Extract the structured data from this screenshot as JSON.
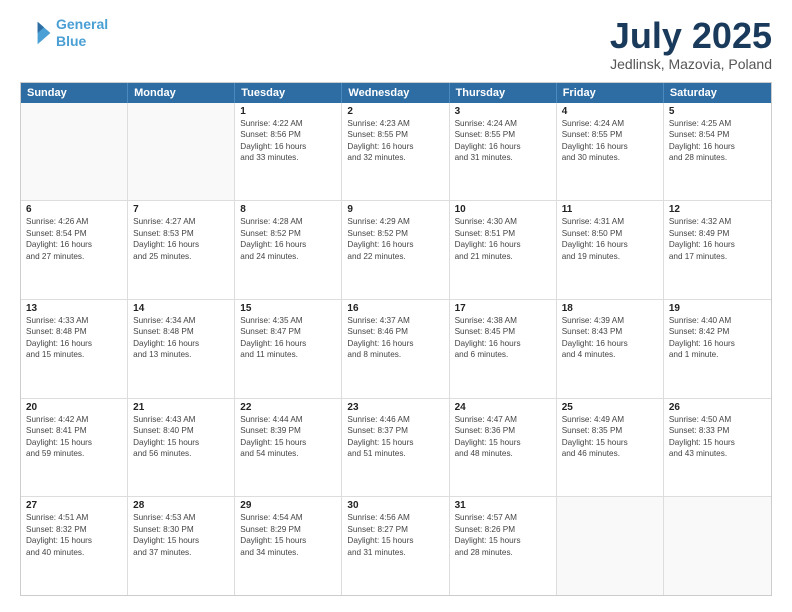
{
  "logo": {
    "line1": "General",
    "line2": "Blue"
  },
  "title": "July 2025",
  "subtitle": "Jedlinsk, Mazovia, Poland",
  "header_days": [
    "Sunday",
    "Monday",
    "Tuesday",
    "Wednesday",
    "Thursday",
    "Friday",
    "Saturday"
  ],
  "weeks": [
    [
      {
        "day": "",
        "lines": []
      },
      {
        "day": "",
        "lines": []
      },
      {
        "day": "1",
        "lines": [
          "Sunrise: 4:22 AM",
          "Sunset: 8:56 PM",
          "Daylight: 16 hours",
          "and 33 minutes."
        ]
      },
      {
        "day": "2",
        "lines": [
          "Sunrise: 4:23 AM",
          "Sunset: 8:55 PM",
          "Daylight: 16 hours",
          "and 32 minutes."
        ]
      },
      {
        "day": "3",
        "lines": [
          "Sunrise: 4:24 AM",
          "Sunset: 8:55 PM",
          "Daylight: 16 hours",
          "and 31 minutes."
        ]
      },
      {
        "day": "4",
        "lines": [
          "Sunrise: 4:24 AM",
          "Sunset: 8:55 PM",
          "Daylight: 16 hours",
          "and 30 minutes."
        ]
      },
      {
        "day": "5",
        "lines": [
          "Sunrise: 4:25 AM",
          "Sunset: 8:54 PM",
          "Daylight: 16 hours",
          "and 28 minutes."
        ]
      }
    ],
    [
      {
        "day": "6",
        "lines": [
          "Sunrise: 4:26 AM",
          "Sunset: 8:54 PM",
          "Daylight: 16 hours",
          "and 27 minutes."
        ]
      },
      {
        "day": "7",
        "lines": [
          "Sunrise: 4:27 AM",
          "Sunset: 8:53 PM",
          "Daylight: 16 hours",
          "and 25 minutes."
        ]
      },
      {
        "day": "8",
        "lines": [
          "Sunrise: 4:28 AM",
          "Sunset: 8:52 PM",
          "Daylight: 16 hours",
          "and 24 minutes."
        ]
      },
      {
        "day": "9",
        "lines": [
          "Sunrise: 4:29 AM",
          "Sunset: 8:52 PM",
          "Daylight: 16 hours",
          "and 22 minutes."
        ]
      },
      {
        "day": "10",
        "lines": [
          "Sunrise: 4:30 AM",
          "Sunset: 8:51 PM",
          "Daylight: 16 hours",
          "and 21 minutes."
        ]
      },
      {
        "day": "11",
        "lines": [
          "Sunrise: 4:31 AM",
          "Sunset: 8:50 PM",
          "Daylight: 16 hours",
          "and 19 minutes."
        ]
      },
      {
        "day": "12",
        "lines": [
          "Sunrise: 4:32 AM",
          "Sunset: 8:49 PM",
          "Daylight: 16 hours",
          "and 17 minutes."
        ]
      }
    ],
    [
      {
        "day": "13",
        "lines": [
          "Sunrise: 4:33 AM",
          "Sunset: 8:48 PM",
          "Daylight: 16 hours",
          "and 15 minutes."
        ]
      },
      {
        "day": "14",
        "lines": [
          "Sunrise: 4:34 AM",
          "Sunset: 8:48 PM",
          "Daylight: 16 hours",
          "and 13 minutes."
        ]
      },
      {
        "day": "15",
        "lines": [
          "Sunrise: 4:35 AM",
          "Sunset: 8:47 PM",
          "Daylight: 16 hours",
          "and 11 minutes."
        ]
      },
      {
        "day": "16",
        "lines": [
          "Sunrise: 4:37 AM",
          "Sunset: 8:46 PM",
          "Daylight: 16 hours",
          "and 8 minutes."
        ]
      },
      {
        "day": "17",
        "lines": [
          "Sunrise: 4:38 AM",
          "Sunset: 8:45 PM",
          "Daylight: 16 hours",
          "and 6 minutes."
        ]
      },
      {
        "day": "18",
        "lines": [
          "Sunrise: 4:39 AM",
          "Sunset: 8:43 PM",
          "Daylight: 16 hours",
          "and 4 minutes."
        ]
      },
      {
        "day": "19",
        "lines": [
          "Sunrise: 4:40 AM",
          "Sunset: 8:42 PM",
          "Daylight: 16 hours",
          "and 1 minute."
        ]
      }
    ],
    [
      {
        "day": "20",
        "lines": [
          "Sunrise: 4:42 AM",
          "Sunset: 8:41 PM",
          "Daylight: 15 hours",
          "and 59 minutes."
        ]
      },
      {
        "day": "21",
        "lines": [
          "Sunrise: 4:43 AM",
          "Sunset: 8:40 PM",
          "Daylight: 15 hours",
          "and 56 minutes."
        ]
      },
      {
        "day": "22",
        "lines": [
          "Sunrise: 4:44 AM",
          "Sunset: 8:39 PM",
          "Daylight: 15 hours",
          "and 54 minutes."
        ]
      },
      {
        "day": "23",
        "lines": [
          "Sunrise: 4:46 AM",
          "Sunset: 8:37 PM",
          "Daylight: 15 hours",
          "and 51 minutes."
        ]
      },
      {
        "day": "24",
        "lines": [
          "Sunrise: 4:47 AM",
          "Sunset: 8:36 PM",
          "Daylight: 15 hours",
          "and 48 minutes."
        ]
      },
      {
        "day": "25",
        "lines": [
          "Sunrise: 4:49 AM",
          "Sunset: 8:35 PM",
          "Daylight: 15 hours",
          "and 46 minutes."
        ]
      },
      {
        "day": "26",
        "lines": [
          "Sunrise: 4:50 AM",
          "Sunset: 8:33 PM",
          "Daylight: 15 hours",
          "and 43 minutes."
        ]
      }
    ],
    [
      {
        "day": "27",
        "lines": [
          "Sunrise: 4:51 AM",
          "Sunset: 8:32 PM",
          "Daylight: 15 hours",
          "and 40 minutes."
        ]
      },
      {
        "day": "28",
        "lines": [
          "Sunrise: 4:53 AM",
          "Sunset: 8:30 PM",
          "Daylight: 15 hours",
          "and 37 minutes."
        ]
      },
      {
        "day": "29",
        "lines": [
          "Sunrise: 4:54 AM",
          "Sunset: 8:29 PM",
          "Daylight: 15 hours",
          "and 34 minutes."
        ]
      },
      {
        "day": "30",
        "lines": [
          "Sunrise: 4:56 AM",
          "Sunset: 8:27 PM",
          "Daylight: 15 hours",
          "and 31 minutes."
        ]
      },
      {
        "day": "31",
        "lines": [
          "Sunrise: 4:57 AM",
          "Sunset: 8:26 PM",
          "Daylight: 15 hours",
          "and 28 minutes."
        ]
      },
      {
        "day": "",
        "lines": []
      },
      {
        "day": "",
        "lines": []
      }
    ]
  ]
}
